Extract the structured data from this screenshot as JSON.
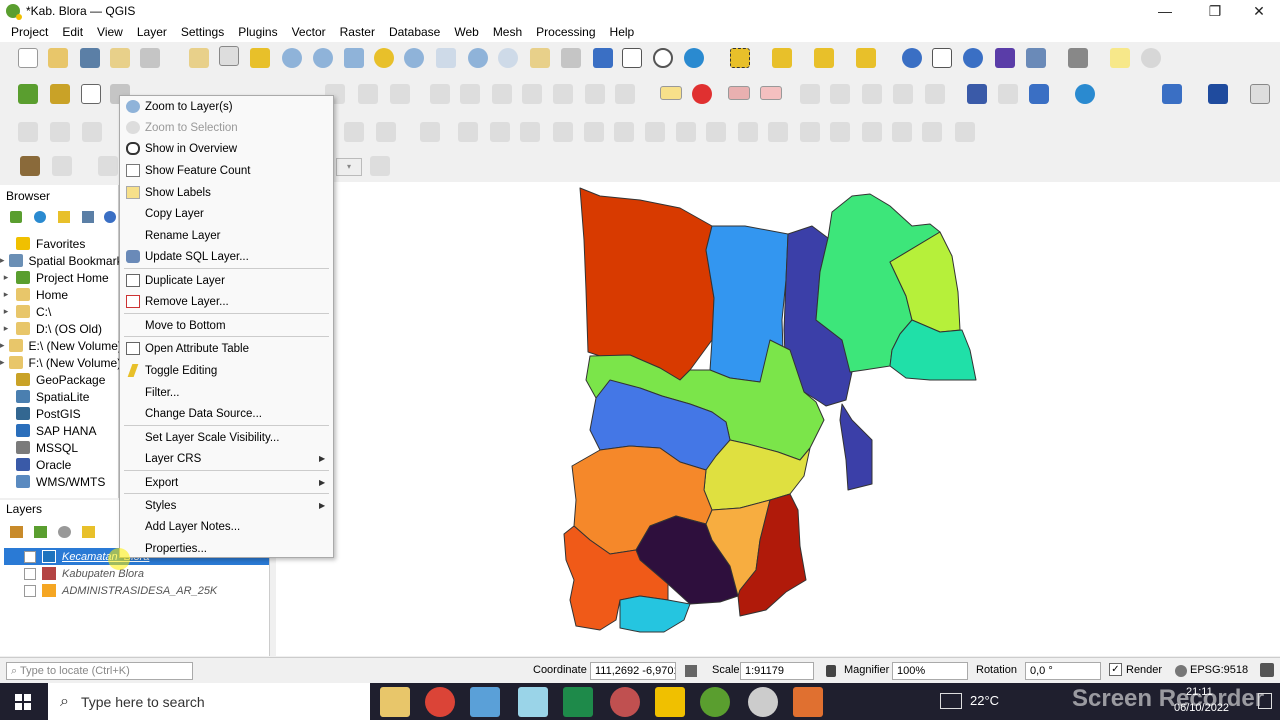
{
  "window": {
    "title": "*Kab. Blora — QGIS",
    "controls": [
      "—",
      "❐",
      "✕"
    ]
  },
  "menubar": [
    "Project",
    "Edit",
    "View",
    "Layer",
    "Settings",
    "Plugins",
    "Vector",
    "Raster",
    "Database",
    "Web",
    "Mesh",
    "Processing",
    "Help"
  ],
  "browser": {
    "title": "Browser",
    "items": [
      {
        "label": "Favorites",
        "icon": "star-icon",
        "color": "#f0c000",
        "arrow": ""
      },
      {
        "label": "Spatial Bookmarks",
        "icon": "bookmark-icon",
        "color": "#6b8fb5",
        "arrow": "▸"
      },
      {
        "label": "Project Home",
        "icon": "project-home-icon",
        "color": "#5a9e2f",
        "arrow": "▸"
      },
      {
        "label": "Home",
        "icon": "folder-icon",
        "color": "#e8c66a",
        "arrow": "▸"
      },
      {
        "label": "C:\\",
        "icon": "folder-icon",
        "color": "#e8c66a",
        "arrow": "▸"
      },
      {
        "label": "D:\\ (OS Old)",
        "icon": "folder-icon",
        "color": "#e8c66a",
        "arrow": "▸"
      },
      {
        "label": "E:\\ (New Volume)",
        "icon": "folder-icon",
        "color": "#e8c66a",
        "arrow": "▸"
      },
      {
        "label": "F:\\ (New Volume)",
        "icon": "folder-icon",
        "color": "#e8c66a",
        "arrow": "▸"
      },
      {
        "label": "GeoPackage",
        "icon": "geopackage-icon",
        "color": "#c9a227",
        "arrow": ""
      },
      {
        "label": "SpatiaLite",
        "icon": "spatialite-icon",
        "color": "#4a7fb0",
        "arrow": ""
      },
      {
        "label": "PostGIS",
        "icon": "postgis-icon",
        "color": "#336791",
        "arrow": ""
      },
      {
        "label": "SAP HANA",
        "icon": "sap-hana-icon",
        "color": "#2a6ebb",
        "arrow": ""
      },
      {
        "label": "MSSQL",
        "icon": "mssql-icon",
        "color": "#7b7b7b",
        "arrow": ""
      },
      {
        "label": "Oracle",
        "icon": "oracle-icon",
        "color": "#3a5aa8",
        "arrow": ""
      },
      {
        "label": "WMS/WMTS",
        "icon": "wms-icon",
        "color": "#5a8ac0",
        "arrow": ""
      }
    ]
  },
  "layers": {
    "title": "Layers",
    "items": [
      {
        "label": "Kecamatan_Blora",
        "checked": "✓",
        "color": "#1e73be",
        "selected": true
      },
      {
        "label": "Kabupaten Blora",
        "checked": "",
        "color": "#b44444",
        "selected": false
      },
      {
        "label": "ADMINISTRASIDESA_AR_25K",
        "checked": "",
        "color": "#f5a623",
        "selected": false
      }
    ]
  },
  "context_menu": [
    {
      "label": "Zoom to Layer(s)",
      "icon": "zoom-layer-icon",
      "disabled": false,
      "submenu": false
    },
    {
      "label": "Zoom to Selection",
      "icon": "zoom-selection-icon",
      "disabled": true,
      "submenu": false
    },
    {
      "label": "Show in Overview",
      "icon": "overview-icon",
      "disabled": false,
      "submenu": false
    },
    {
      "label": "Show Feature Count",
      "icon": "checkbox-icon",
      "disabled": false,
      "submenu": false
    },
    {
      "label": "Show Labels",
      "icon": "labels-icon",
      "disabled": false,
      "submenu": false
    },
    {
      "label": "Copy Layer",
      "icon": "",
      "disabled": false,
      "submenu": false
    },
    {
      "label": "Rename Layer",
      "icon": "",
      "disabled": false,
      "submenu": false
    },
    {
      "label": "Update SQL Layer...",
      "icon": "sql-icon",
      "disabled": false,
      "submenu": false
    },
    {
      "label": "Duplicate Layer",
      "icon": "duplicate-icon",
      "disabled": false,
      "submenu": false
    },
    {
      "label": "Remove Layer...",
      "icon": "remove-icon",
      "disabled": false,
      "submenu": false
    },
    {
      "label": "Move to Bottom",
      "icon": "",
      "disabled": false,
      "submenu": false
    },
    {
      "label": "Open Attribute Table",
      "icon": "table-icon",
      "disabled": false,
      "submenu": false
    },
    {
      "label": "Toggle Editing",
      "icon": "pencil-icon",
      "disabled": false,
      "submenu": false
    },
    {
      "label": "Filter...",
      "icon": "",
      "disabled": false,
      "submenu": false
    },
    {
      "label": "Change Data Source...",
      "icon": "",
      "disabled": false,
      "submenu": false
    },
    {
      "label": "Set Layer Scale Visibility...",
      "icon": "",
      "disabled": false,
      "submenu": false
    },
    {
      "label": "Layer CRS",
      "icon": "",
      "disabled": false,
      "submenu": true
    },
    {
      "label": "Export",
      "icon": "",
      "disabled": false,
      "submenu": true
    },
    {
      "label": "Styles",
      "icon": "",
      "disabled": false,
      "submenu": true
    },
    {
      "label": "Add Layer Notes...",
      "icon": "",
      "disabled": false,
      "submenu": false
    },
    {
      "label": "Properties...",
      "icon": "",
      "disabled": false,
      "submenu": false
    }
  ],
  "status": {
    "locate_placeholder": "Type to locate (Ctrl+K)",
    "coordinate_label": "Coordinate",
    "coordinate_value": "111,2692 -6,9701",
    "scale_label": "Scale",
    "scale_value": "1:91179",
    "magnifier_label": "Magnifier",
    "magnifier_value": "100%",
    "rotation_label": "Rotation",
    "rotation_value": "0,0 °",
    "render_label": "Render",
    "crs": "EPSG:9518"
  },
  "taskbar": {
    "search_placeholder": "Type here to search",
    "temperature": "22°C",
    "time": "21:11",
    "date": "06/10/2022",
    "watermark": "Screen Recorder"
  },
  "map_regions": [
    {
      "name": "region-north-west",
      "color": "#d83a00"
    },
    {
      "name": "region-north-center",
      "color": "#3396f0"
    },
    {
      "name": "region-north-strip",
      "color": "#3b3fa8"
    },
    {
      "name": "region-north-east",
      "color": "#3de67a"
    },
    {
      "name": "region-far-north-east",
      "color": "#b6f03a"
    },
    {
      "name": "region-east",
      "color": "#20e0a8"
    },
    {
      "name": "region-middle-lime",
      "color": "#7be54a"
    },
    {
      "name": "region-middle-blue",
      "color": "#4477e6"
    },
    {
      "name": "region-center-yellow",
      "color": "#dfe040"
    },
    {
      "name": "region-south-west-orange",
      "color": "#f5882a"
    },
    {
      "name": "region-south-center-dark",
      "color": "#2e0f3d"
    },
    {
      "name": "region-south-light-orange",
      "color": "#f7ad40"
    },
    {
      "name": "region-south-east-red",
      "color": "#b01a0a"
    },
    {
      "name": "region-south-west-deep",
      "color": "#f05a18"
    },
    {
      "name": "region-south-cyan",
      "color": "#25c5e0"
    }
  ]
}
